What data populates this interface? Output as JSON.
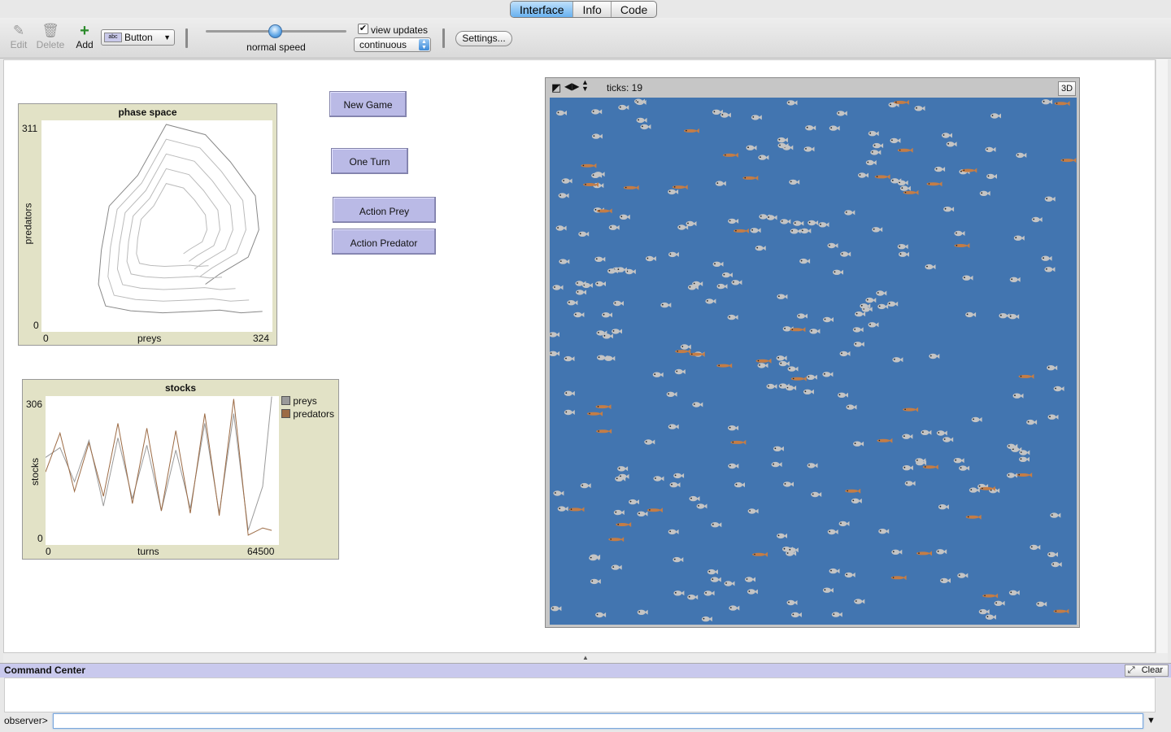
{
  "tabs": [
    {
      "label": "Interface"
    },
    {
      "label": "Info"
    },
    {
      "label": "Code"
    }
  ],
  "toolbar": {
    "edit_label": "Edit",
    "delete_label": "Delete",
    "add_label": "Add",
    "widget_type": "Button",
    "speed_label": "normal speed",
    "speed_value": 0.5,
    "view_updates_label": "view updates",
    "view_updates_checked": true,
    "update_mode": "continuous",
    "settings_label": "Settings..."
  },
  "buttons": {
    "new_game": "New Game",
    "one_turn": "One Turn",
    "action_prey": "Action Prey",
    "action_predator": "Action Predator"
  },
  "phase_plot": {
    "title": "phase space",
    "xlabel": "preys",
    "ylabel": "predators",
    "xmin": "0",
    "xmax": "324",
    "ymin": "0",
    "ymax": "311"
  },
  "stocks_plot": {
    "title": "stocks",
    "xlabel": "turns",
    "ylabel": "stocks",
    "xmin": "0",
    "xmax": "64500",
    "ymin": "0",
    "ymax": "306",
    "legend": [
      {
        "name": "preys",
        "color": "#9a9a9a"
      },
      {
        "name": "predators",
        "color": "#9c6b45"
      }
    ]
  },
  "world": {
    "ticks_label": "ticks: 19",
    "btn_3d": "3D",
    "background_color": "#4275b0",
    "prey_color": "#c4c4c4",
    "predator_color": "#c47d46"
  },
  "command_center": {
    "title": "Command Center",
    "clear_label": "Clear",
    "prompt": "observer>"
  },
  "chart_data": [
    {
      "type": "line",
      "title": "phase space",
      "xlabel": "preys",
      "ylabel": "predators",
      "xlim": [
        0,
        324
      ],
      "ylim": [
        0,
        311
      ],
      "series": [
        {
          "x": [
            310,
            280,
            250,
            215,
            170,
            125,
            90,
            80,
            84,
            95,
            135,
            175,
            230,
            265,
            300,
            305,
            290,
            250,
            230
          ],
          "y": [
            30,
            28,
            32,
            30,
            28,
            31,
            38,
            70,
            120,
            185,
            230,
            305,
            290,
            250,
            200,
            150,
            110,
            85,
            70
          ]
        }
      ]
    },
    {
      "type": "line",
      "title": "stocks",
      "xlabel": "turns",
      "ylabel": "stocks",
      "xlim": [
        0,
        64500
      ],
      "ylim": [
        0,
        306
      ],
      "categories": [
        0,
        4000,
        8000,
        12000,
        16000,
        20000,
        24000,
        28000,
        32000,
        36000,
        40000,
        44000,
        48000,
        52000,
        56000,
        60000,
        62500
      ],
      "series": [
        {
          "name": "preys",
          "values": [
            180,
            200,
            130,
            215,
            80,
            220,
            95,
            205,
            70,
            195,
            75,
            250,
            65,
            270,
            30,
            120,
            305
          ]
        },
        {
          "name": "predators",
          "values": [
            150,
            230,
            110,
            210,
            100,
            250,
            85,
            240,
            70,
            235,
            65,
            270,
            60,
            300,
            20,
            35,
            30
          ]
        }
      ]
    }
  ]
}
